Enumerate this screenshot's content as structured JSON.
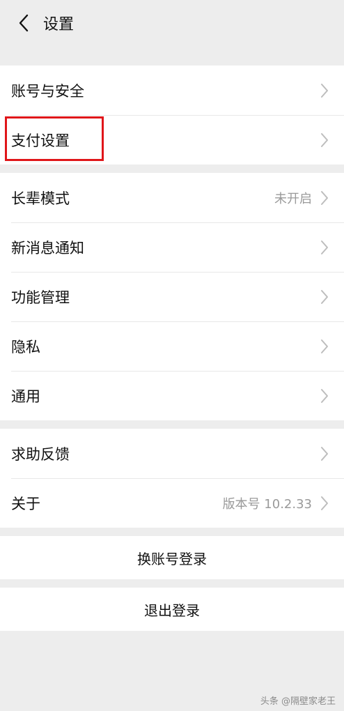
{
  "header": {
    "title": "设置"
  },
  "groups": [
    {
      "items": [
        {
          "label": "账号与安全"
        },
        {
          "label": "支付设置"
        }
      ]
    },
    {
      "items": [
        {
          "label": "长辈模式",
          "value": "未开启"
        },
        {
          "label": "新消息通知"
        },
        {
          "label": "功能管理"
        },
        {
          "label": "隐私"
        },
        {
          "label": "通用"
        }
      ]
    },
    {
      "items": [
        {
          "label": "求助反馈"
        },
        {
          "label": "关于",
          "value": "版本号 10.2.33"
        }
      ]
    }
  ],
  "actions": {
    "switch_account": "换账号登录",
    "logout": "退出登录"
  },
  "watermark": "头条 @隔壁家老王",
  "colors": {
    "background": "#ededed",
    "highlight": "#e0161a",
    "secondary_text": "#9a9a9a"
  },
  "icons": {
    "back": "chevron-left-icon",
    "row_arrow": "chevron-right-icon"
  }
}
